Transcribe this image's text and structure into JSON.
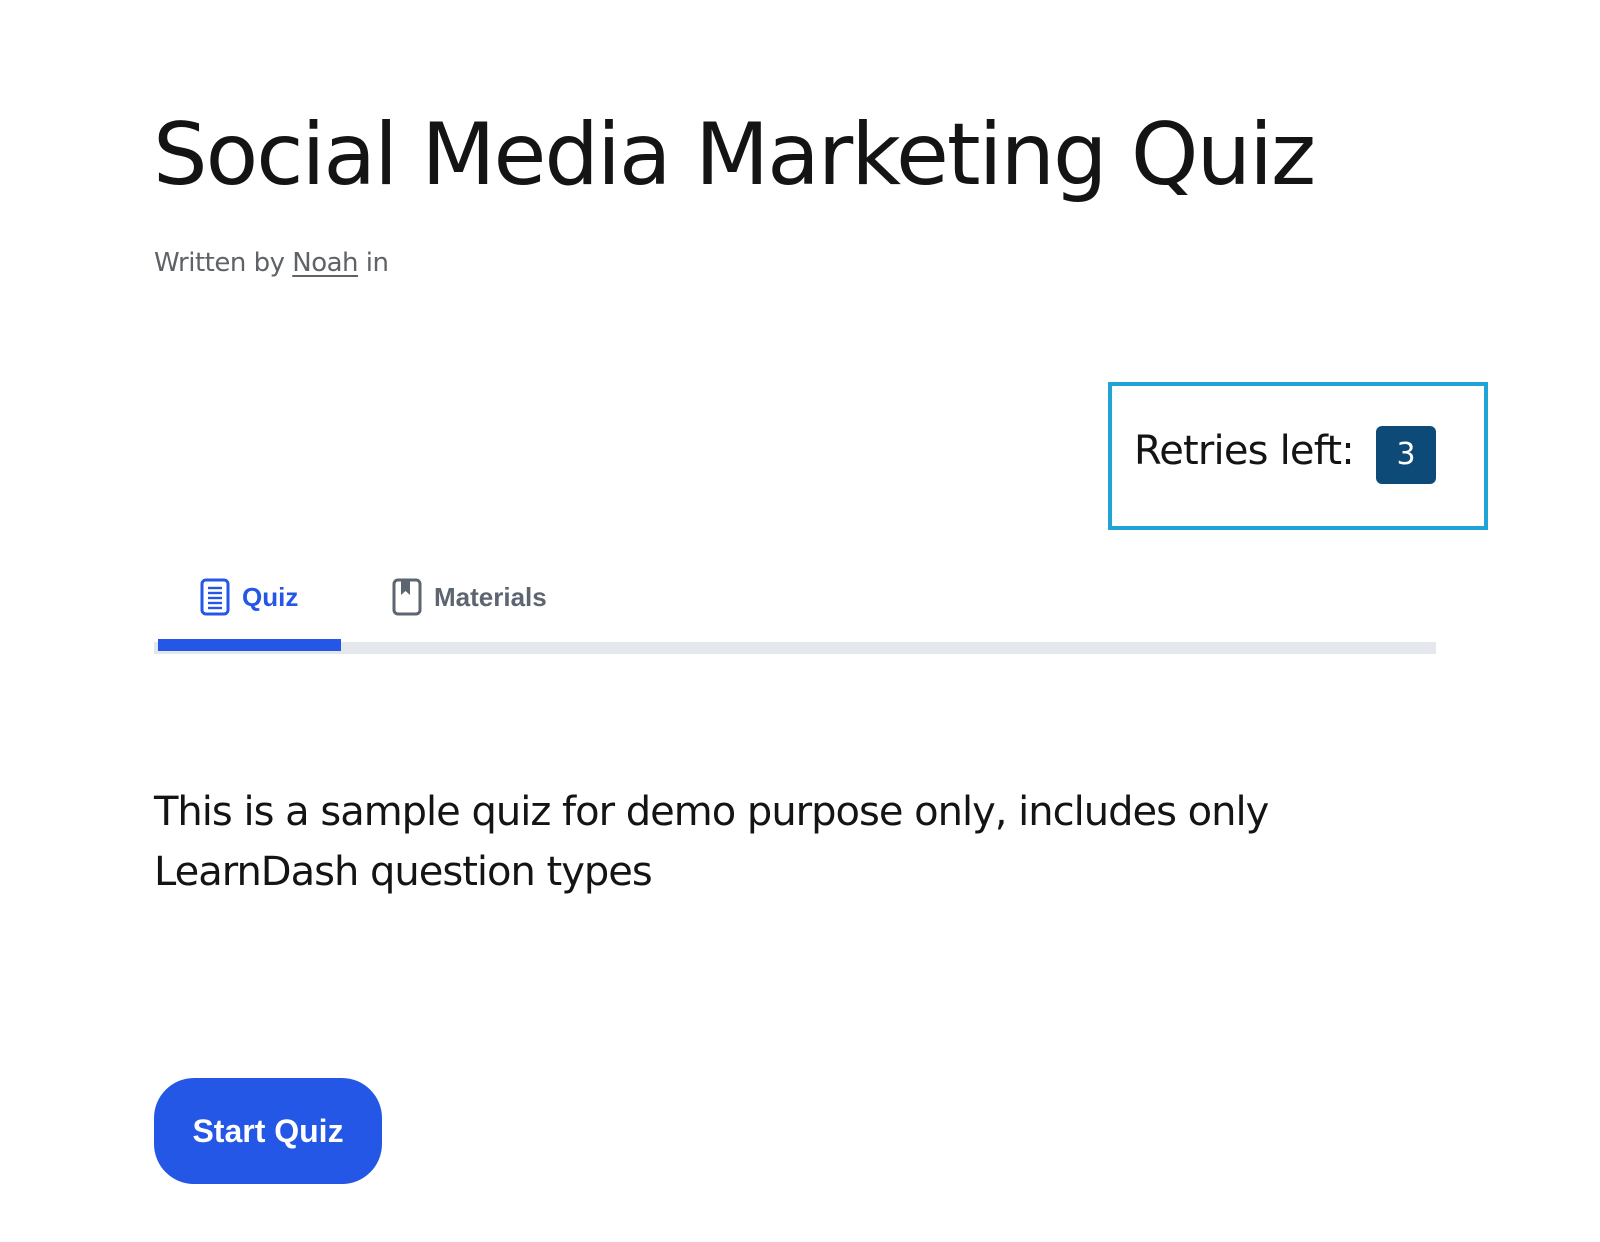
{
  "page": {
    "title": "Social Media Marketing Quiz",
    "byline": {
      "prefix": "Written by",
      "author": "Noah",
      "suffix": "in"
    }
  },
  "retries": {
    "label": "Retries left:",
    "count": "3"
  },
  "tabs": [
    {
      "label": "Quiz",
      "icon": "document-icon",
      "active": true
    },
    {
      "label": "Materials",
      "icon": "bookmark-icon",
      "active": false
    }
  ],
  "content": {
    "description": "This is a sample quiz for demo purpose only, includes only LearnDash question types"
  },
  "actions": {
    "start_label": "Start Quiz"
  },
  "colors": {
    "accent": "#2457e6",
    "retries_border": "#1fa4d6",
    "retries_badge": "#0d4a78",
    "tab_inactive": "#5d6670",
    "track": "#e4e7ec"
  }
}
